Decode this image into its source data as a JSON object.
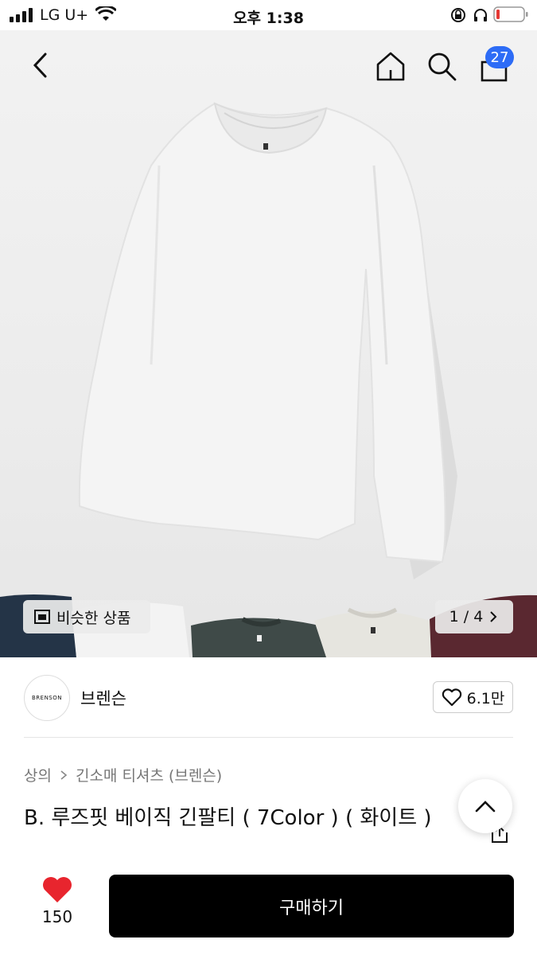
{
  "status_bar": {
    "carrier": "LG U+",
    "time": "오후 1:38"
  },
  "nav": {
    "cart_count": "27"
  },
  "hero": {
    "similar_label": "비슷한 상품",
    "page_indicator": "1 / 4"
  },
  "brand": {
    "logo_text": "BRENSON",
    "name": "브렌슨",
    "likes": "6.1만"
  },
  "product": {
    "breadcrumb": [
      "상의",
      "긴소매 티셔츠 (브렌슨)"
    ],
    "title": "B. 루즈핏 베이직 긴팔티 ( 7Color ) ( 화이트 )"
  },
  "bottom": {
    "heart_count": "150",
    "buy_label": "구매하기"
  },
  "colors": {
    "badge": "#2d6cf6",
    "heart": "#e8252e",
    "buy_button": "#000000"
  }
}
